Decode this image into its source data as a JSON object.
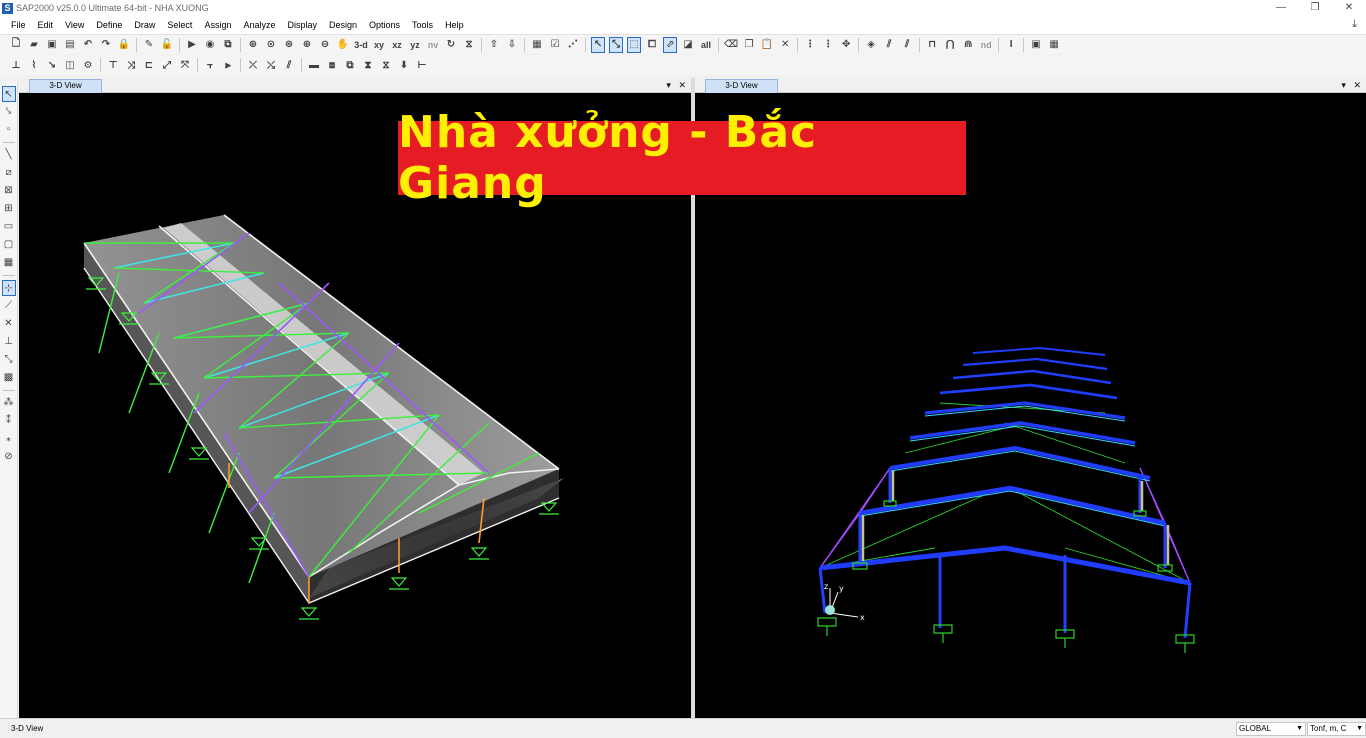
{
  "window": {
    "app_icon_letter": "S",
    "title": "SAP2000 v25.0.0 Ultimate 64-bit - NHA XUONG",
    "minimize": "—",
    "maximize": "❐",
    "close": "✕"
  },
  "menu": [
    "File",
    "Edit",
    "View",
    "Define",
    "Draw",
    "Select",
    "Assign",
    "Analyze",
    "Display",
    "Design",
    "Options",
    "Tools",
    "Help"
  ],
  "toolbar_text": {
    "view_3d": "3-d",
    "view_xy": "xy",
    "view_xz": "xz",
    "view_yz": "yz",
    "view_nv": "nv",
    "all": "all",
    "nd": "nd"
  },
  "left_panel": {
    "tab": "3-D View",
    "menu_caret": "▾",
    "close": "✕"
  },
  "right_panel": {
    "tab": "3-D View",
    "menu_caret": "▾",
    "close": "✕"
  },
  "banner": {
    "text": "Nhà xưởng - Bắc Giang"
  },
  "axis_labels": {
    "x": "x",
    "y": "y",
    "z": "z"
  },
  "status": {
    "view": "3-D View",
    "coord_system": "GLOBAL",
    "units": "Tonf, m, C"
  }
}
